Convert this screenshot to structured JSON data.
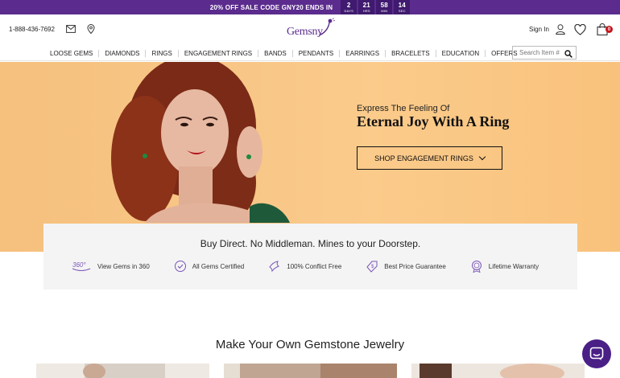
{
  "promo": {
    "text": "20% OFF SALE",
    "code_text": "CODE GNY20",
    "ends_text": "ENDS IN",
    "countdown": [
      {
        "value": "2",
        "unit": "DAYS"
      },
      {
        "value": "21",
        "unit": "HRS"
      },
      {
        "value": "58",
        "unit": "MIN"
      },
      {
        "value": "14",
        "unit": "SEC"
      }
    ]
  },
  "header": {
    "phone": "1-888-436-7692",
    "logo_text": "Gemsny",
    "signin_label": "Sign In",
    "cart_count": "0"
  },
  "nav": {
    "items": [
      "LOOSE GEMS",
      "DIAMONDS",
      "RINGS",
      "ENGAGEMENT RINGS",
      "BANDS",
      "PENDANTS",
      "EARRINGS",
      "BRACELETS",
      "EDUCATION",
      "OFFERS"
    ],
    "search_placeholder": "Search Item #"
  },
  "hero": {
    "subtitle": "Express The Feeling Of",
    "title": "Eternal Joy With A Ring",
    "button_label": "SHOP ENGAGEMENT RINGS"
  },
  "value_panel": {
    "title": "Buy Direct. No Middleman. Mines to your Doorstep.",
    "features": [
      {
        "icon": "360-icon",
        "label": "View Gems in 360"
      },
      {
        "icon": "certified-icon",
        "label": "All Gems Certified"
      },
      {
        "icon": "dove-icon",
        "label": "100% Conflict Free"
      },
      {
        "icon": "price-tag-icon",
        "label": "Best Price Guarantee"
      },
      {
        "icon": "warranty-icon",
        "label": "Lifetime Warranty"
      }
    ]
  },
  "section": {
    "title": "Make Your Own Gemstone Jewelry"
  },
  "colors": {
    "brand_purple": "#5b2c8e",
    "hero_bg": "#f8c787",
    "badge_red": "#c4141b"
  }
}
